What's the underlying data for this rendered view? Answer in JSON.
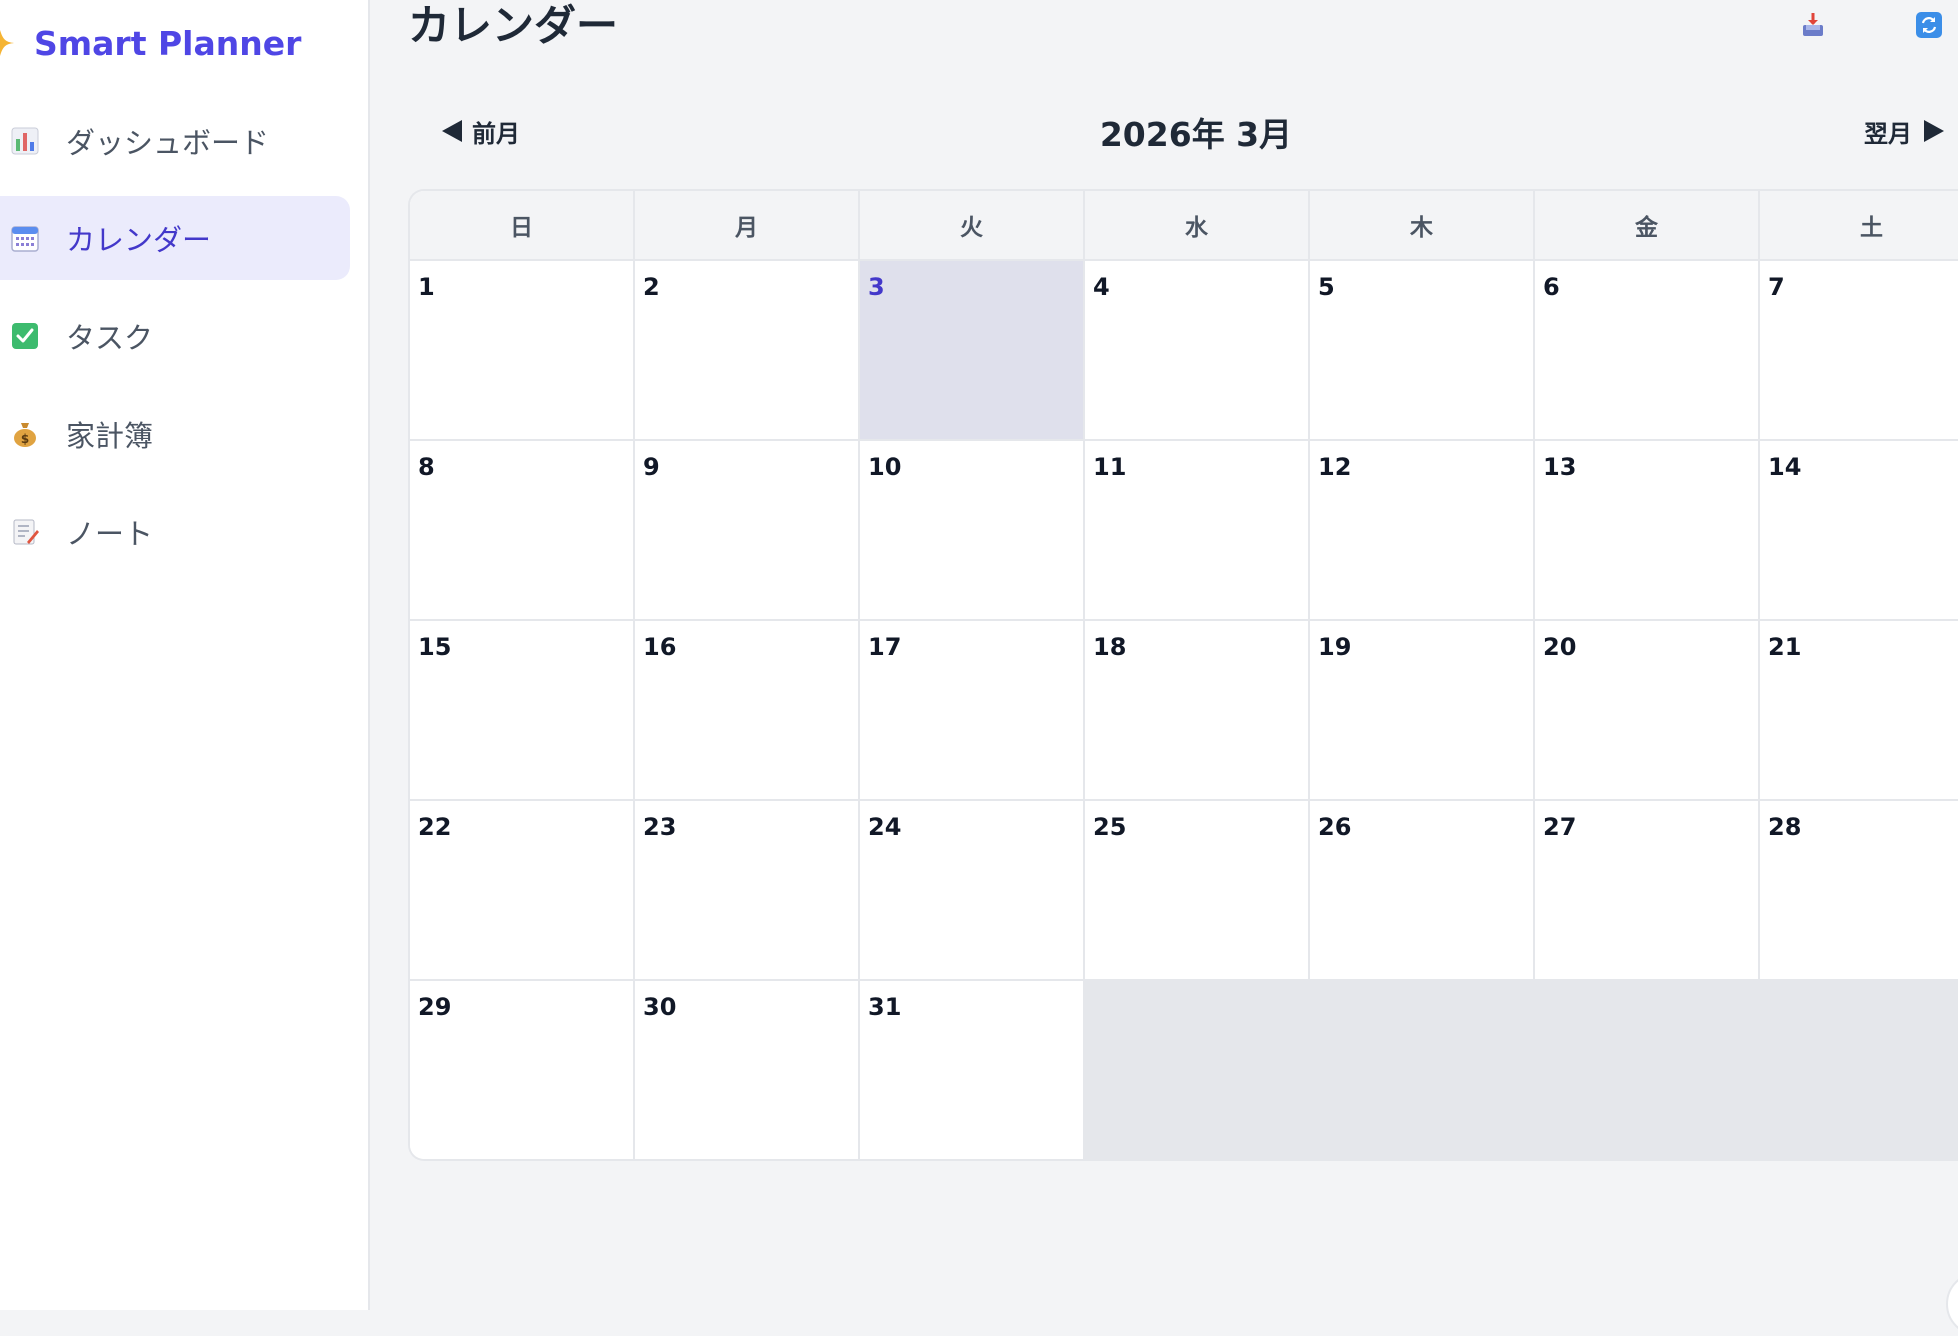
{
  "app": {
    "name": "Smart Planner",
    "brand_icon": "sparkle-icon"
  },
  "sidebar": {
    "items": [
      {
        "label": "ダッシュボード",
        "icon": "bar-chart-icon",
        "active": false
      },
      {
        "label": "カレンダー",
        "icon": "calendar-icon",
        "active": true
      },
      {
        "label": "タスク",
        "icon": "check-box-icon",
        "active": false
      },
      {
        "label": "家計簿",
        "icon": "money-bag-icon",
        "active": false
      },
      {
        "label": "ノート",
        "icon": "memo-icon",
        "active": false
      }
    ]
  },
  "header": {
    "title": "カレンダー",
    "actions": [
      {
        "icon": "inbox-tray-icon"
      },
      {
        "icon": "refresh-icon"
      }
    ]
  },
  "calendar": {
    "prev_label": "前月",
    "next_label": "翌月",
    "month_label": "2026年 3月",
    "today": "3",
    "weekdays": [
      "日",
      "月",
      "火",
      "水",
      "木",
      "金",
      "土"
    ],
    "weeks": [
      [
        "1",
        "2",
        "3",
        "4",
        "5",
        "6",
        "7"
      ],
      [
        "8",
        "9",
        "10",
        "11",
        "12",
        "13",
        "14"
      ],
      [
        "15",
        "16",
        "17",
        "18",
        "19",
        "20",
        "21"
      ],
      [
        "22",
        "23",
        "24",
        "25",
        "26",
        "27",
        "28"
      ],
      [
        "29",
        "30",
        "31",
        "",
        "",
        "",
        ""
      ]
    ]
  },
  "colors": {
    "accent": "#4f46e5",
    "active_nav_bg": "#ebebfc",
    "today_bg": "#dfe0ec",
    "empty_cell_bg": "#e5e7eb",
    "page_bg": "#f3f4f6"
  }
}
